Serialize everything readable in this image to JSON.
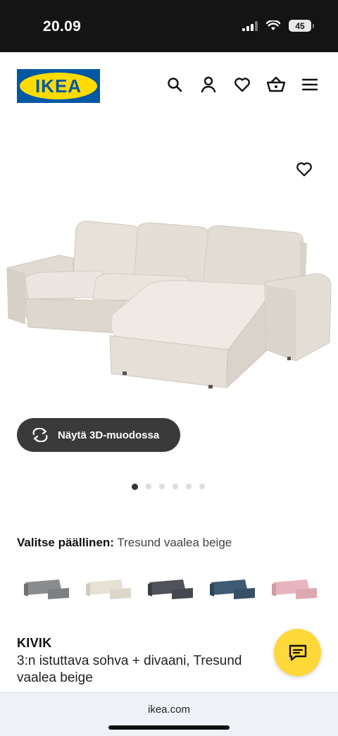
{
  "status_bar": {
    "time": "20.09",
    "battery": "45"
  },
  "header": {
    "logo_text": "IKEA",
    "nav_icons": [
      "search-icon",
      "account-icon",
      "wishlist-icon",
      "cart-icon",
      "menu-icon"
    ]
  },
  "gallery": {
    "view_3d_label": "Näytä 3D-muodossa",
    "dot_count": 6,
    "active_dot": 1
  },
  "cover": {
    "label": "Valitse päällinen:",
    "value": "Tresund vaalea beige",
    "swatches": [
      {
        "name": "grey",
        "color": "#8a8c8e"
      },
      {
        "name": "light-beige",
        "color": "#e6e1d5"
      },
      {
        "name": "dark-grey",
        "color": "#4f5258"
      },
      {
        "name": "blue",
        "color": "#3f5a73"
      },
      {
        "name": "pink",
        "color": "#e6b5bd"
      }
    ]
  },
  "product": {
    "name": "KIVIK",
    "description": "3:n istuttava sohva + divaani, Tresund vaalea beige"
  },
  "browser": {
    "url": "ikea.com"
  },
  "colors": {
    "ikea_blue": "#0058a3",
    "ikea_yellow": "#ffdb00",
    "chat_yellow": "#ffd83a"
  }
}
